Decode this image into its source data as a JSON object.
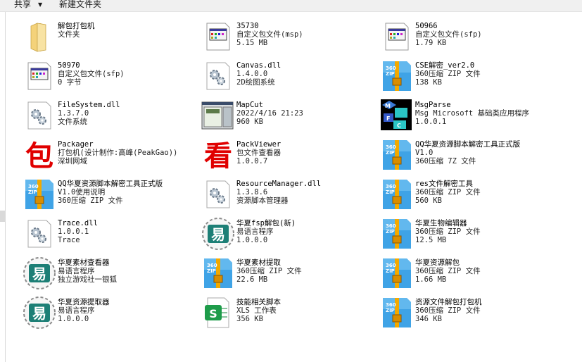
{
  "toolbar": {
    "share_label": "共享",
    "share_arrow": "▼",
    "new_folder_label": "新建文件夹"
  },
  "files": [
    {
      "icon": "folder-icon",
      "lines": [
        "解包打包机",
        "文件夹"
      ]
    },
    {
      "icon": "msp-file-icon",
      "lines": [
        "35730",
        "自定义包文件(msp)",
        "5.15 MB"
      ]
    },
    {
      "icon": "sfp-file-icon",
      "lines": [
        "50966",
        "自定义包文件(sfp)",
        "1.79 KB"
      ]
    },
    {
      "icon": "sfp-file-icon",
      "lines": [
        "50970",
        "自定义包文件(sfp)",
        "0 字节"
      ]
    },
    {
      "icon": "dll-gear-icon",
      "lines": [
        "Canvas.dll",
        "1.4.0.0",
        "2D绘图系统"
      ]
    },
    {
      "icon": "360zip-archive-icon",
      "lines": [
        "CSE解密_ver2.0",
        "360压缩 ZIP 文件",
        "138 KB"
      ]
    },
    {
      "icon": "dll-gear-icon",
      "lines": [
        "FileSystem.dll",
        "1.3.7.0",
        "文件系统"
      ]
    },
    {
      "icon": "mapcut-app-icon",
      "lines": [
        "MapCut",
        "2022/4/16 21:23",
        "960 KB"
      ]
    },
    {
      "icon": "msgparse-mfc-icon",
      "lines": [
        "MsgParse",
        "Msg Microsoft 基础类应用程序",
        "1.0.0.1"
      ]
    },
    {
      "icon": "bao-character-icon",
      "lines": [
        "Packager",
        "打包机(设计制作:高峰(PeakGao))",
        "深圳网域"
      ]
    },
    {
      "icon": "kan-character-icon",
      "lines": [
        "PackViewer",
        "包文件查看器",
        "1.0.0.7"
      ]
    },
    {
      "icon": "360zip-archive-icon",
      "lines": [
        "QQ华夏资源脚本解密工具正式版",
        "V1.0",
        "360压缩 7Z 文件"
      ]
    },
    {
      "icon": "360zip-archive-icon",
      "lines": [
        "QQ华夏资源脚本解密工具正式版",
        "V1.0使用说明",
        "360压缩 ZIP 文件"
      ]
    },
    {
      "icon": "dll-gear-icon",
      "lines": [
        "ResourceManager.dll",
        "1.3.8.6",
        "资源脚本管理器"
      ]
    },
    {
      "icon": "360zip-archive-icon",
      "lines": [
        "res文件解密工具",
        "360压缩 ZIP 文件",
        "560 KB"
      ]
    },
    {
      "icon": "dll-gear-icon",
      "lines": [
        "Trace.dll",
        "1.0.0.1",
        "Trace"
      ]
    },
    {
      "icon": "yi-language-icon",
      "lines": [
        "华夏fsp解包(新)",
        "易语言程序",
        "1.0.0.0"
      ]
    },
    {
      "icon": "360zip-archive-icon",
      "lines": [
        "华夏生物编辑器",
        "360压缩 ZIP 文件",
        "12.5 MB"
      ]
    },
    {
      "icon": "yi-language-icon",
      "lines": [
        "华夏素材查看器",
        "易语言程序",
        "独立游戏社一银狐"
      ]
    },
    {
      "icon": "360zip-archive-icon",
      "lines": [
        "华夏素材提取",
        "360压缩 ZIP 文件",
        "22.6 MB"
      ]
    },
    {
      "icon": "360zip-archive-icon",
      "lines": [
        "华夏资源解包",
        "360压缩 ZIP 文件",
        "1.66 MB"
      ]
    },
    {
      "icon": "yi-language-icon",
      "lines": [
        "华夏资源提取器",
        "易语言程序",
        "1.0.0.0"
      ]
    },
    {
      "icon": "xls-spreadsheet-icon",
      "lines": [
        "技能相关脚本",
        "XLS 工作表",
        "356 KB"
      ]
    },
    {
      "icon": "360zip-archive-icon",
      "lines": [
        "资源文件解包打包机",
        "360压缩 ZIP 文件",
        "346 KB"
      ]
    }
  ],
  "colors": {
    "zip_blue": "#3fa3e6",
    "zip_belt": "#f2a900",
    "folder_yellow": "#f4d27a",
    "red_glyph": "#e00000",
    "xls_green": "#1e9c4a"
  },
  "glyphs": {
    "bao": "包",
    "kan": "看",
    "yi": "易",
    "zip_text": "360\nZIP",
    "xls": "S"
  }
}
